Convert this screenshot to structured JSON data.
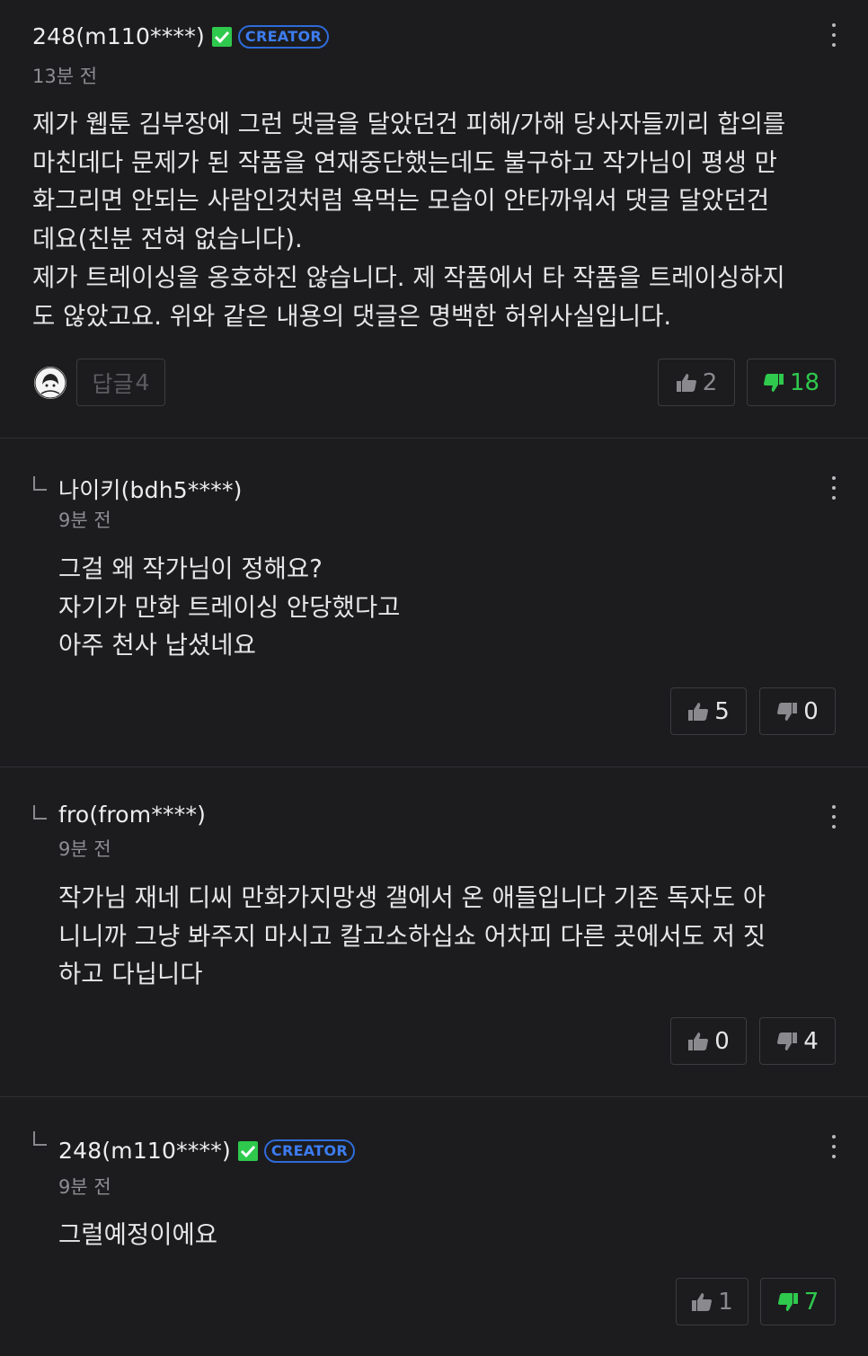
{
  "comments": [
    {
      "author": "248(m110****)",
      "is_creator": true,
      "badge_label": "CREATOR",
      "time": "13분 전",
      "lines": [
        "제가 웹툰 김부장에 그런 댓글을 달았던건 피해/가해 당사자들끼리 합의를",
        "마친데다 문제가 된 작품을 연재중단했는데도 불구하고 작가님이 평생 만",
        "화그리면 안되는 사람인것처럼 욕먹는 모습이 안타까워서 댓글 달았던건",
        "데요(친분 전혀 없습니다).",
        "제가 트레이싱을 옹호하진 않습니다. 제 작품에서 타 작품을 트레이싱하지",
        "도 않았고요. 위와 같은 내용의 댓글은 명백한 허위사실입니다."
      ],
      "reply_label": "답글",
      "reply_count": "4",
      "likes": "2",
      "dislikes": "18"
    },
    {
      "author": "나이키(bdh5****)",
      "time": "9분 전",
      "lines": [
        "그걸 왜 작가님이 정해요?",
        "자기가 만화 트레이싱 안당했다고",
        "아주 천사 납셨네요"
      ],
      "likes": "5",
      "dislikes": "0"
    },
    {
      "author": "fro(from****)",
      "time": "9분 전",
      "lines": [
        "작가님 재네 디씨 만화가지망생 갤에서 온 애들입니다 기존 독자도 아",
        "니니까 그냥 봐주지 마시고 칼고소하십쇼 어차피 다른 곳에서도 저 짓",
        "하고 다닙니다"
      ],
      "likes": "0",
      "dislikes": "4"
    },
    {
      "author": "248(m110****)",
      "is_creator": true,
      "badge_label": "CREATOR",
      "time": "9분 전",
      "lines": [
        "그럴예정이에요"
      ],
      "likes": "1",
      "dislikes": "7"
    }
  ],
  "colors": {
    "background": "#1c1c1e",
    "creator_badge": "#3d7cf0",
    "verified_check": "#2fc94e",
    "dislike_active": "#2fc94e",
    "vote_inactive": "#8a8a8e"
  },
  "icons": [
    "verified-check-icon",
    "more-options-icon",
    "thumbs-up-icon",
    "thumbs-down-icon",
    "reply-arrow-icon",
    "avatar"
  ]
}
